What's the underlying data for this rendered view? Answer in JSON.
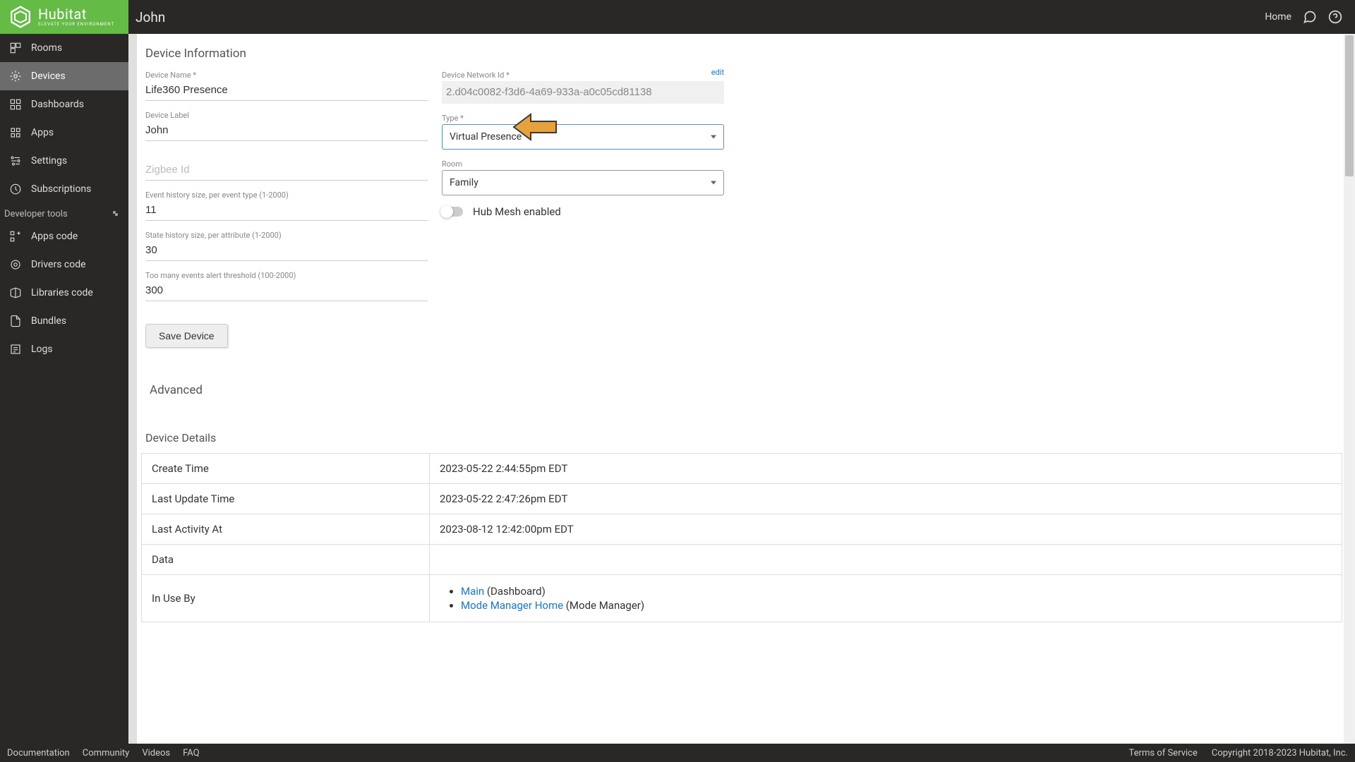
{
  "header": {
    "logo_main": "Hubitat",
    "logo_sub": "ELEVATE YOUR ENVIRONMENT",
    "page_title": "John",
    "home_label": "Home"
  },
  "sidebar": {
    "items": [
      {
        "label": "Rooms"
      },
      {
        "label": "Devices"
      },
      {
        "label": "Dashboards"
      },
      {
        "label": "Apps"
      },
      {
        "label": "Settings"
      },
      {
        "label": "Subscriptions"
      }
    ],
    "dev_section": "Developer tools",
    "dev_items": [
      {
        "label": "Apps code"
      },
      {
        "label": "Drivers code"
      },
      {
        "label": "Libraries code"
      },
      {
        "label": "Bundles"
      },
      {
        "label": "Logs"
      }
    ]
  },
  "device_info": {
    "section_title": "Device Information",
    "device_name_label": "Device Name *",
    "device_name_value": "Life360 Presence",
    "device_label_label": "Device Label",
    "device_label_value": "John",
    "zigbee_placeholder": "Zigbee Id",
    "event_history_label": "Event history size, per event type (1-2000)",
    "event_history_value": "11",
    "state_history_label": "State history size, per attribute (1-2000)",
    "state_history_value": "30",
    "too_many_label": "Too many events alert threshold (100-2000)",
    "too_many_value": "300",
    "network_id_label": "Device Network Id *",
    "network_id_value": "2.d04c0082-f3d6-4a69-933a-a0c05cd81138",
    "edit_label": "edit",
    "type_label": "Type *",
    "type_value": "Virtual Presence",
    "room_label": "Room",
    "room_value": "Family",
    "hub_mesh_label": "Hub Mesh enabled",
    "save_label": "Save Device"
  },
  "advanced": {
    "title": "Advanced"
  },
  "details": {
    "title": "Device Details",
    "rows": [
      {
        "label": "Create Time",
        "value": "2023-05-22 2:44:55pm EDT"
      },
      {
        "label": "Last Update Time",
        "value": "2023-05-22 2:47:26pm EDT"
      },
      {
        "label": "Last Activity At",
        "value": "2023-08-12 12:42:00pm EDT"
      },
      {
        "label": "Data",
        "value": ""
      }
    ],
    "in_use_label": "In Use By",
    "in_use_items": [
      {
        "link": "Main",
        "suffix": "  (Dashboard)"
      },
      {
        "link": "Mode Manager",
        "link2": "Home",
        "suffix": "  (Mode Manager)"
      }
    ]
  },
  "footer": {
    "left": [
      "Documentation",
      "Community",
      "Videos",
      "FAQ"
    ],
    "right": [
      "Terms of Service",
      "Copyright 2018-2023 Hubitat, Inc."
    ]
  }
}
